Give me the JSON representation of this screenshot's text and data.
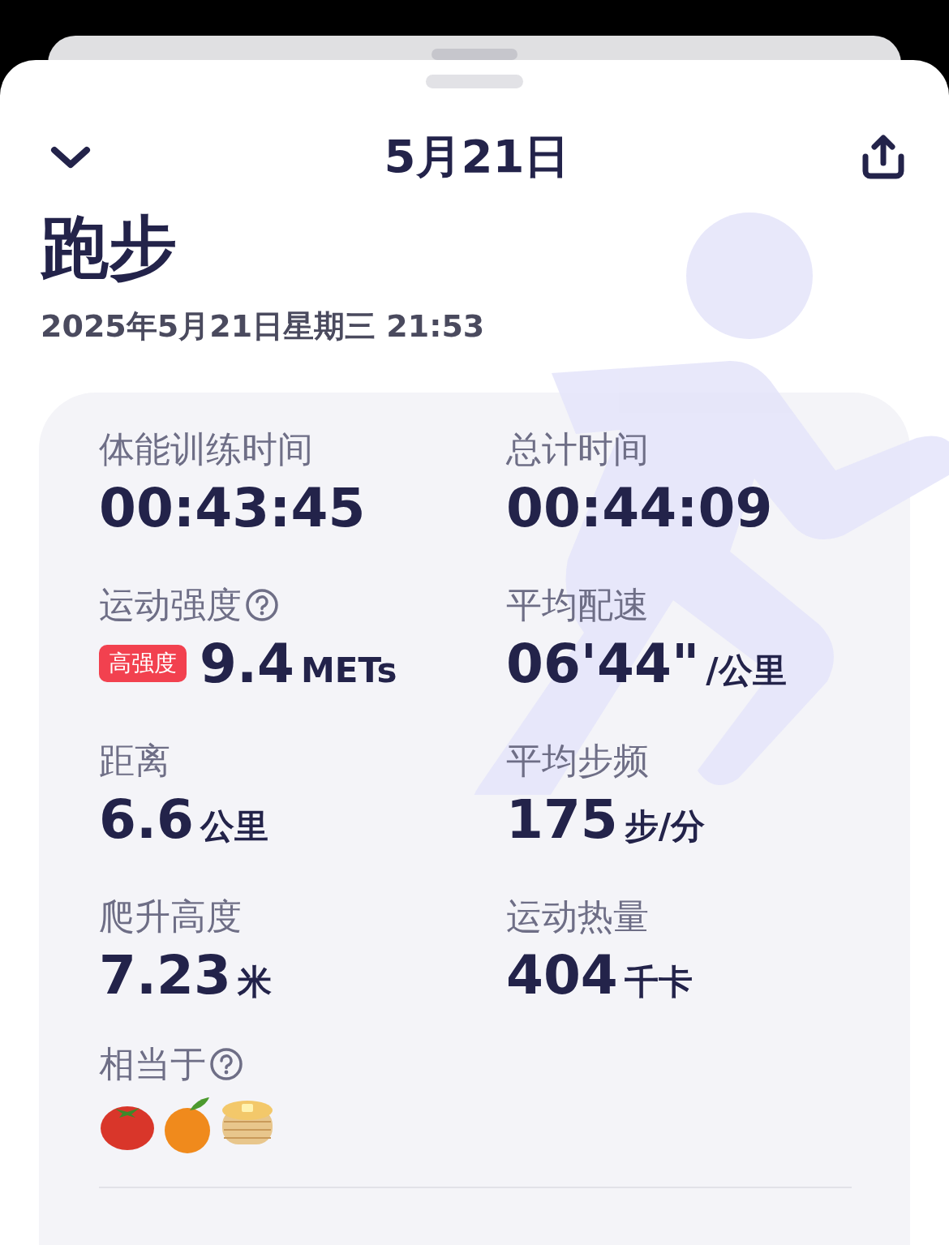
{
  "header": {
    "title": "5月21日"
  },
  "workout": {
    "title": "跑步",
    "datetime": "2025年5月21日星期三 21:53"
  },
  "metrics": [
    {
      "label": "体能训练时间",
      "value": "00:43:45"
    },
    {
      "label": "总计时间",
      "value": "00:44:09"
    },
    {
      "label": "运动强度",
      "help": true,
      "badge": "高强度",
      "value": "9.4",
      "unit": "METs"
    },
    {
      "label": "平均配速",
      "value": "06'44\"",
      "unit": "/公里"
    },
    {
      "label": "距离",
      "value": "6.6",
      "unit": "公里"
    },
    {
      "label": "平均步频",
      "value": "175",
      "unit": "步/分"
    },
    {
      "label": "爬升高度",
      "value": "7.23",
      "unit": "米"
    },
    {
      "label": "运动热量",
      "value": "404",
      "unit": "千卡"
    }
  ],
  "equivalent": {
    "label": "相当于",
    "help": true
  }
}
